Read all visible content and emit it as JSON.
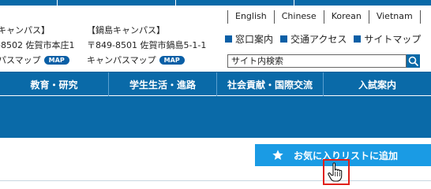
{
  "campus_left": {
    "title": "キャンパス】",
    "address": "-8502 佐賀市本庄1",
    "map_link": "パスマップ",
    "map_badge": "MAP"
  },
  "campus_right": {
    "title": "【鍋島キャンパス】",
    "address": "〒849-8501 佐賀市鍋島5-1-1",
    "map_link": "キャンパスマップ",
    "map_badge": "MAP"
  },
  "languages": [
    "English",
    "Chinese",
    "Korean",
    "Vietnam"
  ],
  "utility_links": [
    "窓口案内",
    "交通アクセス",
    "サイトマップ"
  ],
  "search": {
    "placeholder": "サイト内検索"
  },
  "nav": [
    "教育・研究",
    "学生生活・進路",
    "社会貢献・国際交流",
    "入試案内"
  ],
  "favorite_button": {
    "label": "お気に入りリストに追加"
  },
  "colors": {
    "primary": "#0a6aa8",
    "accent": "#1a9be4",
    "highlight": "#e0201a"
  }
}
